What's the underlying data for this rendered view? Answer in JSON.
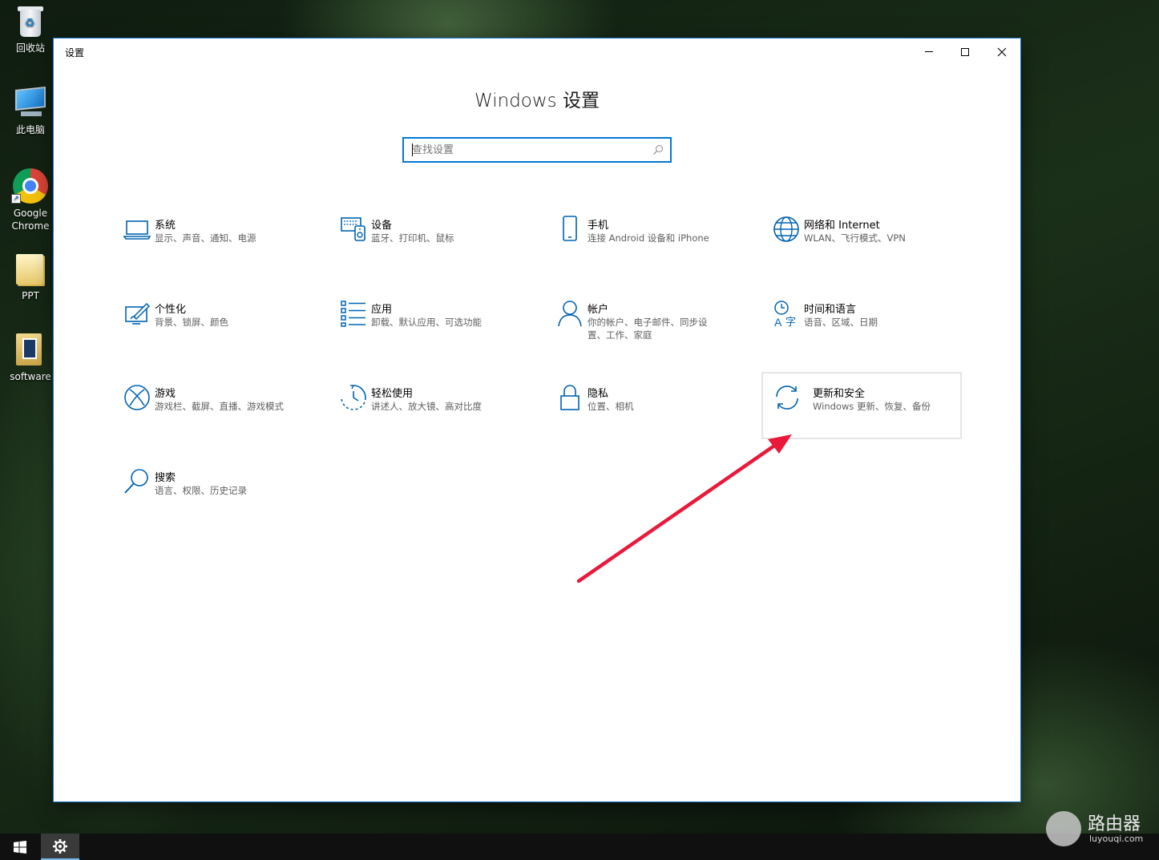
{
  "desktop": {
    "icons": [
      {
        "label": "回收站"
      },
      {
        "label": "此电脑"
      },
      {
        "label": "Google Chrome"
      },
      {
        "label": "PPT"
      },
      {
        "label": "software"
      }
    ]
  },
  "window": {
    "title": "设置",
    "heading": "Windows 设置",
    "search_placeholder": "查找设置",
    "tiles": [
      {
        "title": "系统",
        "subtitle": "显示、声音、通知、电源",
        "icon": "laptop-icon"
      },
      {
        "title": "设备",
        "subtitle": "蓝牙、打印机、鼠标",
        "icon": "devices-icon"
      },
      {
        "title": "手机",
        "subtitle": "连接 Android 设备和 iPhone",
        "icon": "phone-icon"
      },
      {
        "title": "网络和 Internet",
        "subtitle": "WLAN、飞行模式、VPN",
        "icon": "globe-icon"
      },
      {
        "title": "个性化",
        "subtitle": "背景、锁屏、颜色",
        "icon": "personalize-icon"
      },
      {
        "title": "应用",
        "subtitle": "卸载、默认应用、可选功能",
        "icon": "apps-list-icon"
      },
      {
        "title": "帐户",
        "subtitle": "你的帐户、电子邮件、同步设置、工作、家庭",
        "icon": "person-icon"
      },
      {
        "title": "时间和语言",
        "subtitle": "语音、区域、日期",
        "icon": "time-language-icon"
      },
      {
        "title": "游戏",
        "subtitle": "游戏栏、截屏、直播、游戏模式",
        "icon": "xbox-icon"
      },
      {
        "title": "轻松使用",
        "subtitle": "讲述人、放大镜、高对比度",
        "icon": "ease-of-access-icon"
      },
      {
        "title": "隐私",
        "subtitle": "位置、相机",
        "icon": "lock-icon"
      },
      {
        "title": "更新和安全",
        "subtitle": "Windows 更新、恢复、备份",
        "icon": "sync-icon"
      },
      {
        "title": "搜索",
        "subtitle": "语言、权限、历史记录",
        "icon": "search-icon"
      }
    ]
  },
  "watermark": {
    "text": "路由器",
    "url": "luyouqi.com"
  },
  "colors": {
    "accent": "#0078d7",
    "arrow": "#e8193a"
  }
}
